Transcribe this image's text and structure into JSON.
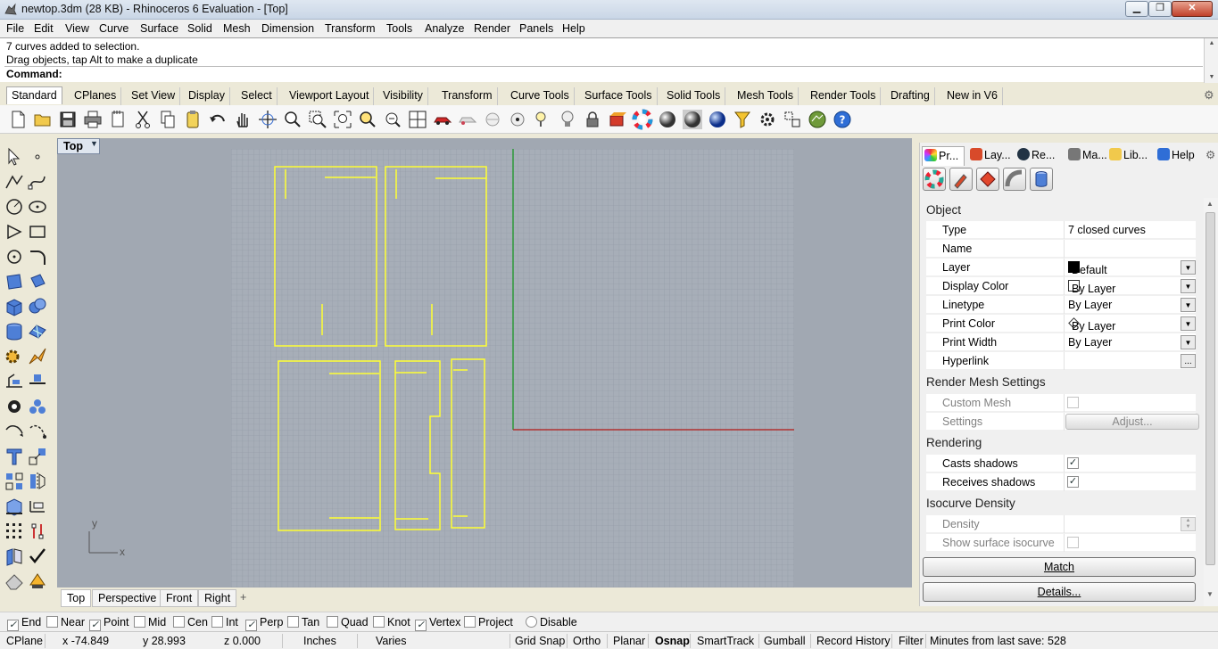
{
  "window": {
    "title": "newtop.3dm (28 KB) - Rhinoceros 6 Evaluation - [Top]"
  },
  "menu": [
    "File",
    "Edit",
    "View",
    "Curve",
    "Surface",
    "Solid",
    "Mesh",
    "Dimension",
    "Transform",
    "Tools",
    "Analyze",
    "Render",
    "Panels",
    "Help"
  ],
  "command": {
    "history": [
      "7 curves added to selection.",
      "Drag objects, tap Alt to make a duplicate"
    ],
    "prompt": "Command:"
  },
  "toolbar_tabs": [
    "Standard",
    "CPlanes",
    "Set View",
    "Display",
    "Select",
    "Viewport Layout",
    "Visibility",
    "Transform",
    "Curve Tools",
    "Surface Tools",
    "Solid Tools",
    "Mesh Tools",
    "Render Tools",
    "Drafting",
    "New in V6"
  ],
  "toolbar_active": "Standard",
  "viewport": {
    "name": "Top",
    "axis_x": "x",
    "axis_y": "y",
    "tabs": [
      "Top",
      "Perspective",
      "Front",
      "Right"
    ],
    "add_tab": "+"
  },
  "panel": {
    "tabs": [
      "Pr...",
      "Lay...",
      "Re...",
      "Ma...",
      "Lib...",
      "Help"
    ],
    "object_section": "Object",
    "object_rows": [
      {
        "key": "Type",
        "value": "7 closed curves"
      },
      {
        "key": "Name",
        "value": ""
      },
      {
        "key": "Layer",
        "value": "Default"
      },
      {
        "key": "Display Color",
        "value": "By Layer"
      },
      {
        "key": "Linetype",
        "value": "By Layer"
      },
      {
        "key": "Print Color",
        "value": "By Layer"
      },
      {
        "key": "Print Width",
        "value": "By Layer"
      },
      {
        "key": "Hyperlink",
        "value": ""
      }
    ],
    "hyperlink_button": "...",
    "render_mesh_section": "Render Mesh Settings",
    "custom_mesh": "Custom Mesh",
    "settings": "Settings",
    "adjust_button": "Adjust...",
    "rendering_section": "Rendering",
    "casts_shadows": "Casts shadows",
    "receives_shadows": "Receives shadows",
    "isocurve_section": "Isocurve Density",
    "density": "Density",
    "show_isocurve": "Show surface isocurve",
    "match_button": "Match",
    "details_button": "Details..."
  },
  "osnaps": [
    {
      "label": "End",
      "checked": true
    },
    {
      "label": "Near",
      "checked": false
    },
    {
      "label": "Point",
      "checked": true
    },
    {
      "label": "Mid",
      "checked": false
    },
    {
      "label": "Cen",
      "checked": false
    },
    {
      "label": "Int",
      "checked": false
    },
    {
      "label": "Perp",
      "checked": true
    },
    {
      "label": "Tan",
      "checked": false
    },
    {
      "label": "Quad",
      "checked": false
    },
    {
      "label": "Knot",
      "checked": false
    },
    {
      "label": "Vertex",
      "checked": true
    },
    {
      "label": "Project",
      "checked": false
    },
    {
      "label": "Disable",
      "checked": false
    }
  ],
  "status": {
    "cplane": "CPlane",
    "x": "x -74.849",
    "y": "y 28.993",
    "z": "z 0.000",
    "units": "Inches",
    "layer": "Varies",
    "grid_snap": "Grid Snap",
    "ortho": "Ortho",
    "planar": "Planar",
    "osnap": "Osnap",
    "smarttrack": "SmartTrack",
    "gumball": "Gumball",
    "record_history": "Record History",
    "filter": "Filter",
    "last_save": "Minutes from last save: 528"
  },
  "colors": {
    "curve": "#ffff33",
    "grid_bg": "#a1a8b2",
    "grid_line": "#96a0aa",
    "axis_x": "#b03030",
    "axis_y": "#2f9a3a"
  }
}
